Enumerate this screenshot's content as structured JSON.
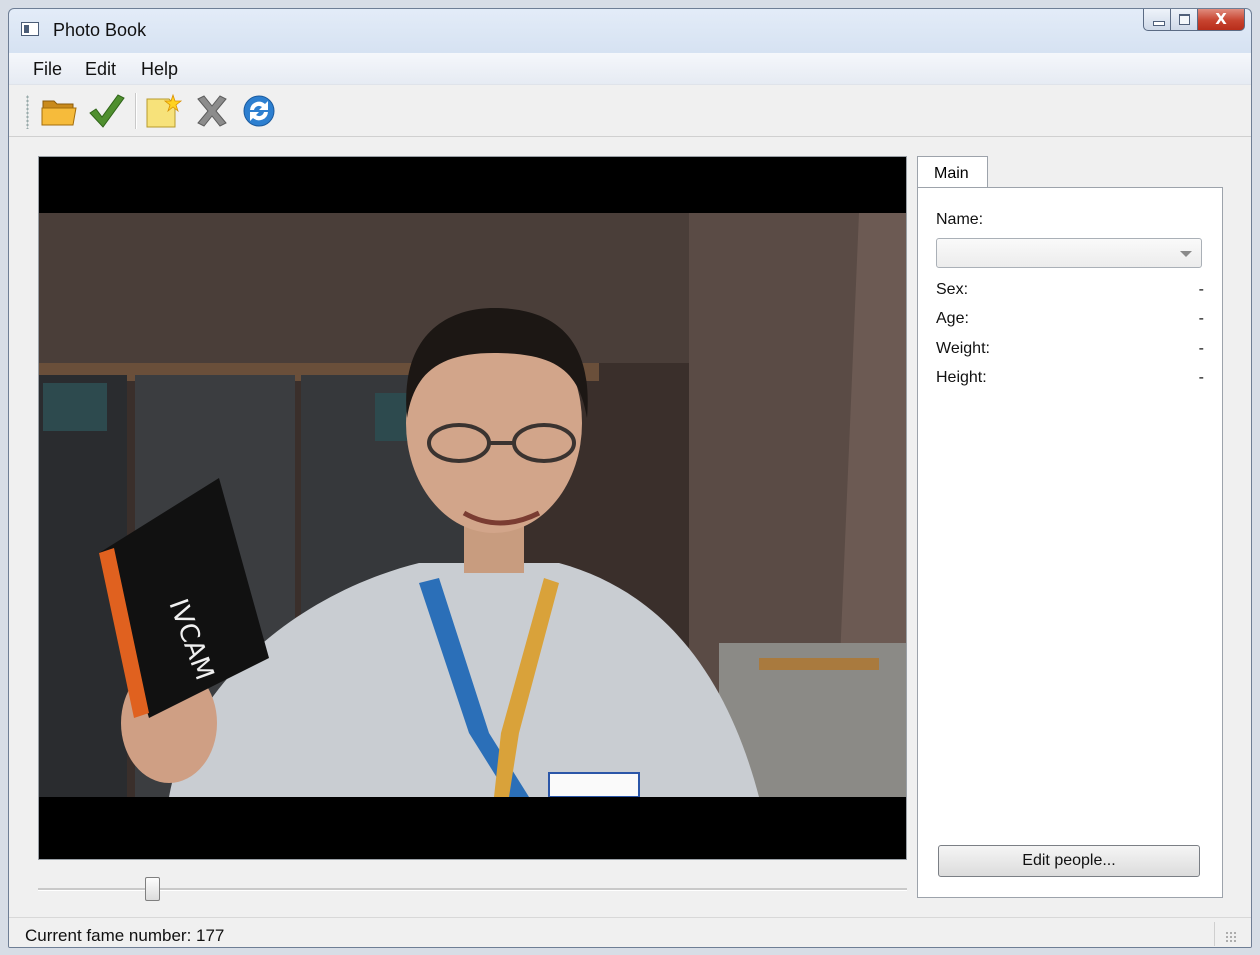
{
  "window": {
    "title": "Photo Book",
    "close_glyph": "X"
  },
  "menu": {
    "items": [
      "File",
      "Edit",
      "Help"
    ]
  },
  "toolbar": {
    "icons": [
      "folder-open-icon",
      "checkmark-icon",
      "new-document-icon",
      "delete-x-icon",
      "refresh-icon"
    ]
  },
  "tabs": {
    "main": "Main"
  },
  "details": {
    "name_label": "Name:",
    "name_value": "",
    "sex_label": "Sex:",
    "sex_value": "-",
    "age_label": "Age:",
    "age_value": "-",
    "weight_label": "Weight:",
    "weight_value": "-",
    "height_label": "Height:",
    "height_value": "-",
    "edit_button": "Edit people..."
  },
  "frame_slider": {
    "level": 0.125
  },
  "status": {
    "text": "Current fame number: 177"
  },
  "colors": {
    "accent_close": "#c7432f",
    "video_background": "#000000"
  }
}
